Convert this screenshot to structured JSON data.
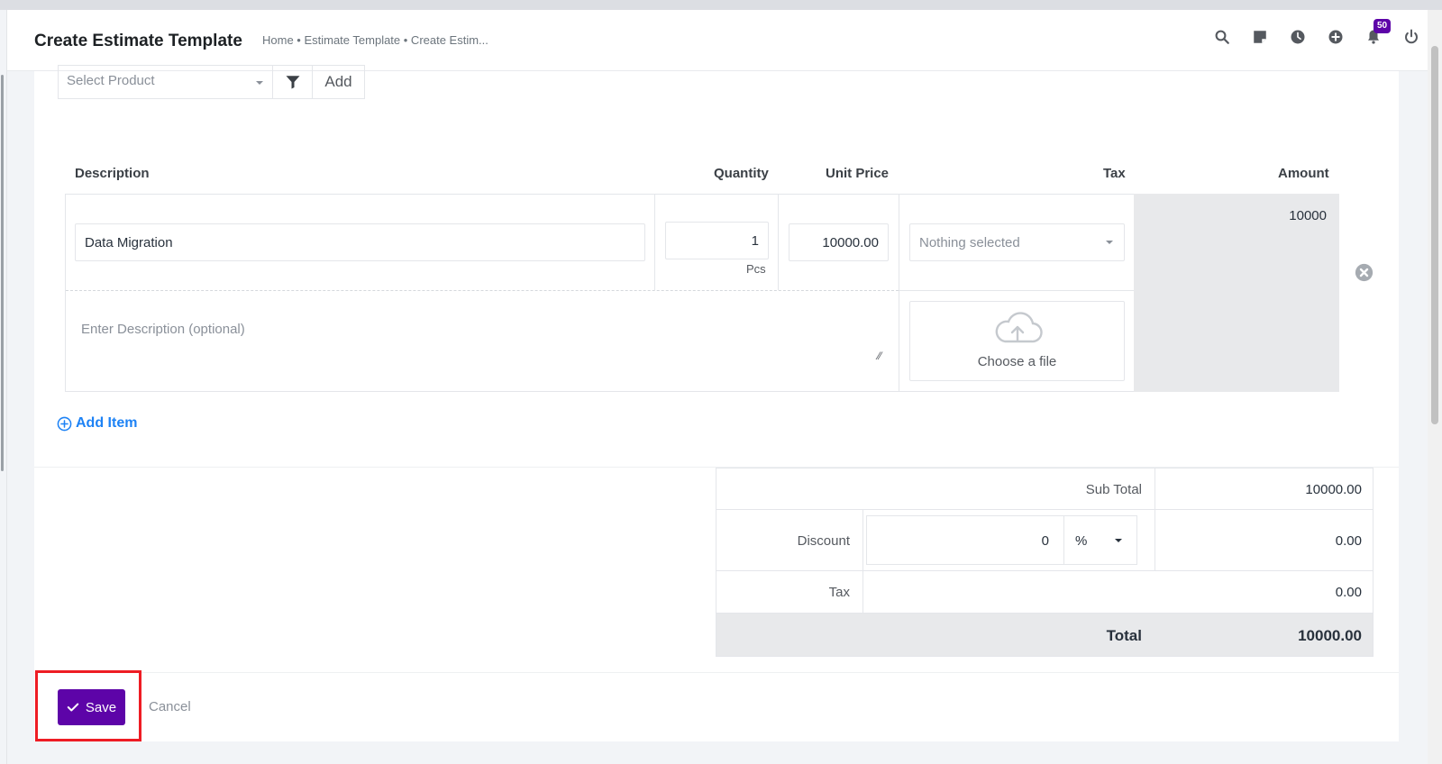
{
  "header": {
    "title": "Create Estimate Template",
    "breadcrumb": "Home • Estimate Template • Create Estim...",
    "notification_count": "50",
    "icons": [
      "search-icon",
      "sticky-note-icon",
      "clock-icon",
      "plus-circle-icon",
      "bell-icon",
      "power-icon"
    ]
  },
  "product_select": {
    "placeholder": "Select Product",
    "add_label": "Add"
  },
  "table": {
    "columns": [
      "Description",
      "Quantity",
      "Unit Price",
      "Tax",
      "Amount"
    ],
    "item": {
      "description": "Data Migration",
      "quantity": "1",
      "unit": "Pcs",
      "unit_price": "10000.00",
      "tax": "Nothing selected",
      "amount": "10000",
      "description_placeholder": "Enter Description (optional)",
      "upload_label": "Choose a file"
    }
  },
  "add_item_label": "Add Item",
  "totals": {
    "subtotal_label": "Sub Total",
    "subtotal": "10000.00",
    "discount_label": "Discount",
    "discount_value": "0",
    "discount_type": "%",
    "discount": "0.00",
    "tax_label": "Tax",
    "tax": "0.00",
    "total_label": "Total",
    "total": "10000.00"
  },
  "actions": {
    "save_label": "Save",
    "cancel_label": "Cancel"
  },
  "colors": {
    "accent": "#5d04a8",
    "link": "#1d82f5",
    "highlight": "#ee1c24"
  }
}
